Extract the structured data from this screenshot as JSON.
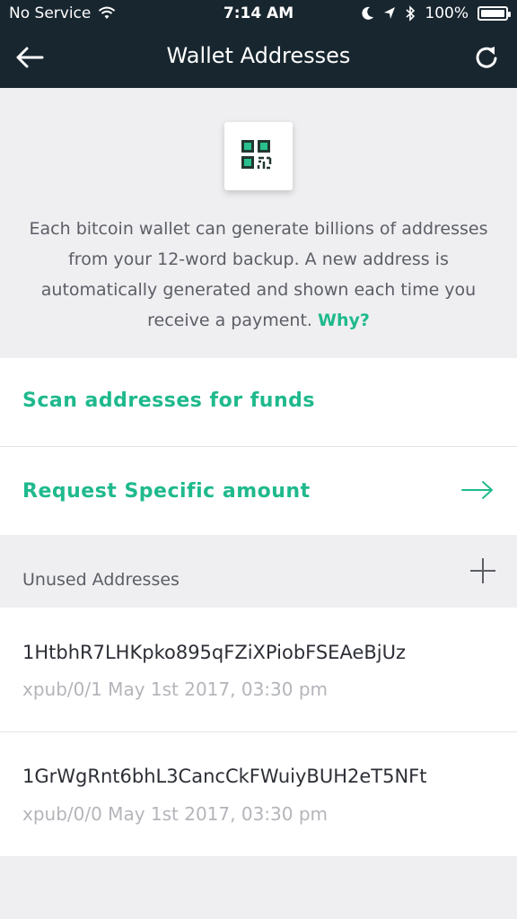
{
  "status_bar": {
    "carrier": "No Service",
    "time": "7:14 AM",
    "battery": "100%",
    "battery_level": 1.0
  },
  "header": {
    "title": "Wallet Addresses",
    "back_icon": "arrow-left-icon",
    "refresh_icon": "refresh-icon"
  },
  "intro": {
    "text": "Each bitcoin wallet can generate billions of addresses from your 12-word backup. A new address is automatically generated and shown each time you receive a payment.",
    "why_link": "Why?"
  },
  "actions": {
    "scan_label": "Scan addresses for funds",
    "request_label": "Request Specific amount"
  },
  "unused_section": {
    "title": "Unused Addresses"
  },
  "addresses": [
    {
      "address": "1HtbhR7LHKpko895qFZiXPiobFSEAeBjUz",
      "meta": "xpub/0/1 May 1st 2017, 03:30 pm"
    },
    {
      "address": "1GrWgRnt6bhL3CancCkFWuiyBUH2eT5NFt",
      "meta": "xpub/0/0 May 1st 2017, 03:30 pm"
    }
  ],
  "colors": {
    "header_bg": "#18262f",
    "accent": "#1fb98d",
    "page_bg": "#efeff1"
  }
}
